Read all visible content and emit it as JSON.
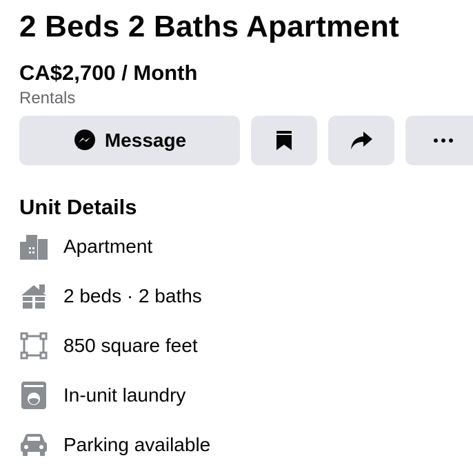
{
  "listing": {
    "title": "2 Beds 2 Baths Apartment",
    "price": "CA$2,700 / Month",
    "category": "Rentals"
  },
  "actions": {
    "message_label": "Message",
    "save_icon": "bookmark-icon",
    "share_icon": "share-arrow-icon",
    "more_icon": "more-dots-icon",
    "button_bg": "#e4e6eb"
  },
  "unit_details": {
    "heading": "Unit Details",
    "items": [
      {
        "icon": "building-icon",
        "label": "Apartment"
      },
      {
        "icon": "house-icon",
        "label": "2 beds · 2 baths"
      },
      {
        "icon": "floor-area-icon",
        "label": "850 square feet"
      },
      {
        "icon": "washing-machine-icon",
        "label": "In-unit laundry"
      },
      {
        "icon": "car-icon",
        "label": "Parking available"
      }
    ]
  },
  "colors": {
    "text_primary": "#050505",
    "text_secondary": "#65676b",
    "icon_gray": "#8a8d91"
  }
}
